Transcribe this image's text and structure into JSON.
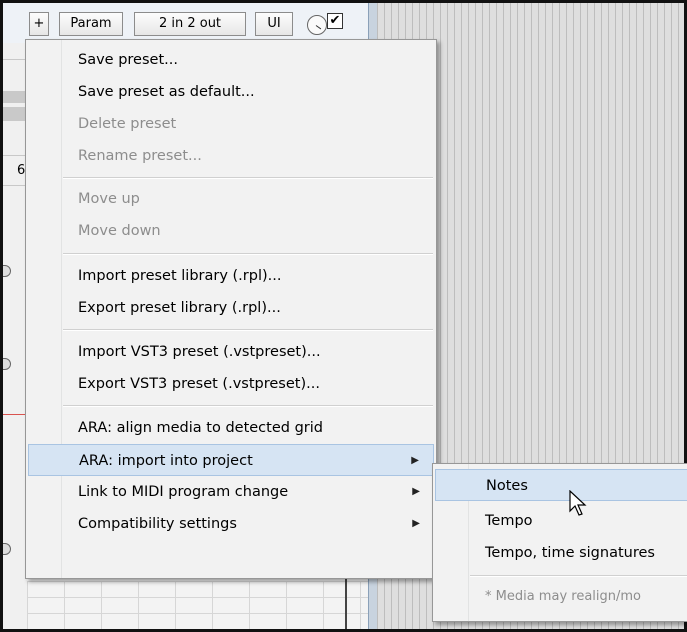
{
  "toolbar": {
    "add_label": "+",
    "param_label": "Param",
    "io_label": "2 in 2 out",
    "ui_label": "UI",
    "checkbox_mark": "✔"
  },
  "left_strip_char": "6",
  "menu": {
    "items": [
      {
        "label": "Save preset...",
        "disabled": false
      },
      {
        "label": "Save preset as default...",
        "disabled": false
      },
      {
        "label": "Delete preset",
        "disabled": true
      },
      {
        "label": "Rename preset...",
        "disabled": true
      },
      {
        "label": "Move up",
        "disabled": true
      },
      {
        "label": "Move down",
        "disabled": true
      },
      {
        "label": "Import preset library (.rpl)...",
        "disabled": false
      },
      {
        "label": "Export preset library (.rpl)...",
        "disabled": false
      },
      {
        "label": "Import VST3 preset (.vstpreset)...",
        "disabled": false
      },
      {
        "label": "Export VST3 preset (.vstpreset)...",
        "disabled": false
      },
      {
        "label": "ARA: align media to detected grid",
        "disabled": false
      },
      {
        "label": "ARA: import into project",
        "disabled": false,
        "submenu": true,
        "highlighted": true
      },
      {
        "label": "Link to MIDI program change",
        "disabled": false,
        "submenu": true
      },
      {
        "label": "Compatibility settings",
        "disabled": false,
        "submenu": true
      }
    ]
  },
  "submenu": {
    "items": [
      {
        "label": "Notes",
        "highlighted": true
      },
      {
        "label": "Tempo"
      },
      {
        "label": "Tempo, time signatures"
      },
      {
        "label": "* Media may realign/mo",
        "disabled": true
      }
    ]
  },
  "colors": {
    "highlight": "#d6e4f3",
    "highlight_border": "#a9c4e2",
    "menu_bg": "#f2f2f2",
    "disabled_text": "#8d8d8d"
  }
}
